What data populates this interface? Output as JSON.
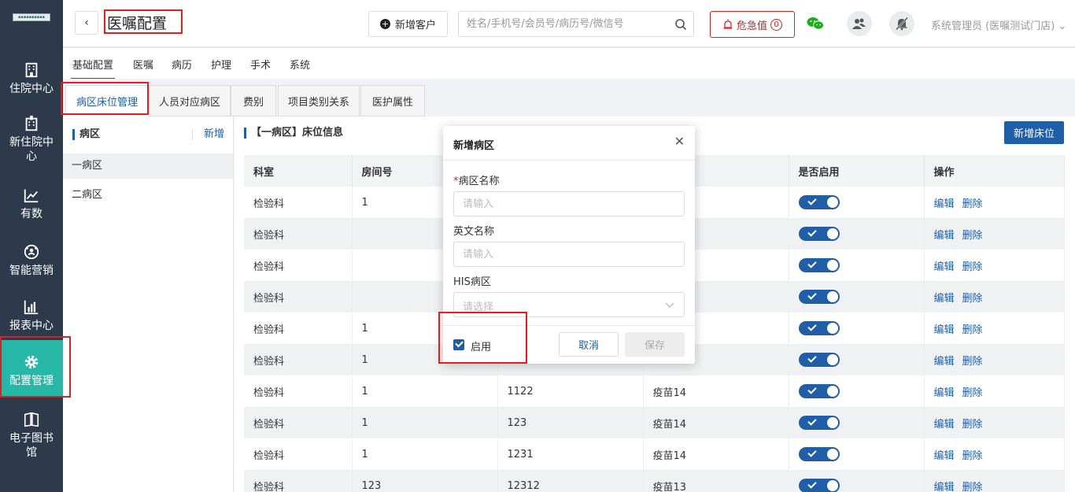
{
  "sidebar": {
    "items": [
      {
        "label": "住院中心",
        "icon": "building-icon"
      },
      {
        "label": "新住院中心",
        "icon": "hospital-icon"
      },
      {
        "label": "有数",
        "icon": "trend-chart-icon"
      },
      {
        "label": "智能营销",
        "icon": "people-network-icon"
      },
      {
        "label": "报表中心",
        "icon": "bar-chart-icon"
      },
      {
        "label": "配置管理",
        "icon": "gear-icon",
        "active": true
      },
      {
        "label": "电子图书馆",
        "icon": "book-icon"
      }
    ]
  },
  "header": {
    "title": "医嘱配置",
    "add_customer_label": "新增客户",
    "search_placeholder": "姓名/手机号/会员号/病历号/微信号",
    "critical_label": "危急值",
    "critical_count": "0",
    "user_label": "系统管理员 (医嘱测试门店)"
  },
  "tabs_primary": [
    "基础配置",
    "医嘱",
    "病历",
    "护理",
    "手术",
    "系统"
  ],
  "tabs_secondary": [
    "病区床位管理",
    "人员对应病区",
    "费别",
    "项目类别关系",
    "医护属性"
  ],
  "ward_panel": {
    "title": "病区",
    "add_label": "新增",
    "wards": [
      "一病区",
      "二病区"
    ]
  },
  "bed_panel": {
    "title": "【一病区】床位信息",
    "new_bed_label": "新增床位",
    "columns": [
      "科室",
      "房间号",
      "",
      "",
      "是否启用",
      "操作"
    ],
    "edit_label": "编辑",
    "delete_label": "删除",
    "rows": [
      {
        "dept": "检验科",
        "room": "1",
        "bed": "",
        "type": ""
      },
      {
        "dept": "检验科",
        "room": "",
        "bed": "",
        "type": ""
      },
      {
        "dept": "检验科",
        "room": "",
        "bed": "",
        "type": ""
      },
      {
        "dept": "检验科",
        "room": "",
        "bed": "",
        "type": ""
      },
      {
        "dept": "检验科",
        "room": "1",
        "bed": "",
        "type": ""
      },
      {
        "dept": "检验科",
        "room": "1",
        "bed": "",
        "type": ""
      },
      {
        "dept": "检验科",
        "room": "1",
        "bed": "1122",
        "type": "疫苗14"
      },
      {
        "dept": "检验科",
        "room": "1",
        "bed": "123",
        "type": "疫苗14"
      },
      {
        "dept": "检验科",
        "room": "1",
        "bed": "1231",
        "type": "疫苗14"
      },
      {
        "dept": "检验科",
        "room": "123",
        "bed": "12312",
        "type": "疫苗13"
      }
    ]
  },
  "modal": {
    "title": "新增病区",
    "name_label": "病区名称",
    "name_placeholder": "请输入",
    "english_label": "英文名称",
    "english_placeholder": "请输入",
    "his_label": "HIS病区",
    "his_placeholder": "请选择",
    "enable_label": "启用",
    "cancel_label": "取消",
    "save_label": "保存"
  },
  "colors": {
    "sidebar_bg": "#2d3a4b",
    "active_nav": "#26b7a6",
    "primary": "#1f5ea8",
    "danger": "#e02020",
    "wechat": "#1aad19"
  }
}
